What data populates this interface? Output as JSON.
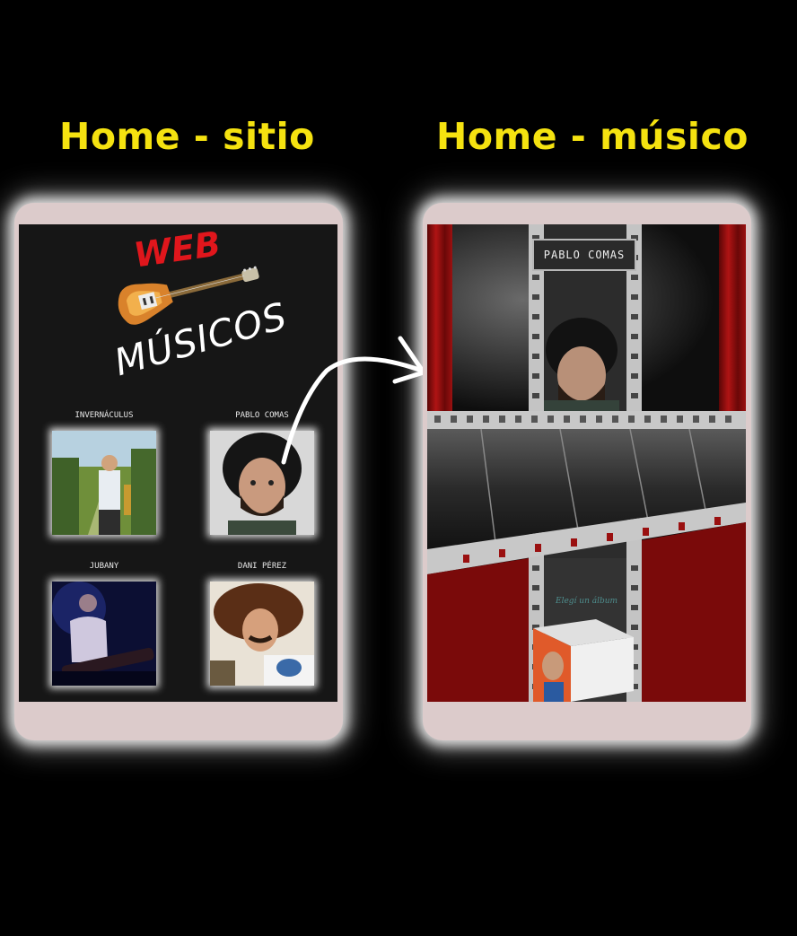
{
  "headings": {
    "left": "Home - sitio",
    "right": "Home - músico"
  },
  "site_home": {
    "logo": {
      "web": "WEB",
      "musicos": "MÚSICOS"
    },
    "musicians": [
      {
        "name": "INVERNÁCULUS"
      },
      {
        "name": "PABLO COMAS"
      },
      {
        "name": "JUBANY"
      },
      {
        "name": "DANI PÉREZ"
      }
    ]
  },
  "musician_home": {
    "name_plate": "PABLO COMAS",
    "album_label": "Elegí un álbum"
  },
  "colors": {
    "heading": "#f5e210",
    "phone_frame": "#dccbcb",
    "curtain_red": "#8c0c0c",
    "logo_red": "#e0161c"
  }
}
